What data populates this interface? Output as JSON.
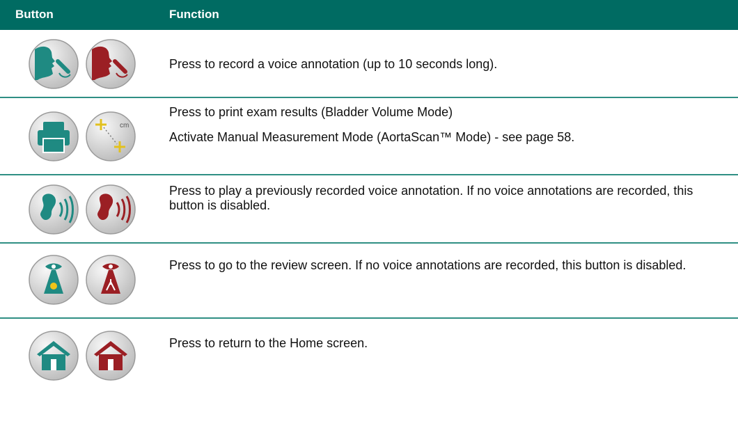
{
  "header": {
    "button": "Button",
    "function": "Function"
  },
  "rows": [
    {
      "icons": [
        "speak-icon-teal",
        "speak-icon-red"
      ],
      "text": [
        "Press to record a voice annotation (up to 10 seconds long)."
      ]
    },
    {
      "icons": [
        "printer-icon",
        "manual-measure-icon"
      ],
      "text": [
        "Press to print exam results (Bladder Volume Mode)",
        "Activate Manual Measurement Mode (AortaScan™ Mode) - see page 58."
      ]
    },
    {
      "icons": [
        "ear-icon-teal",
        "ear-icon-red"
      ],
      "text": [
        "Press to play a previously recorded voice annotation. If no voice annotations are recorded, this button is disabled."
      ]
    },
    {
      "icons": [
        "review-icon-teal",
        "review-icon-red"
      ],
      "text": [
        "Press to go to the review screen. If no voice annotations are recorded, this button is disabled."
      ]
    },
    {
      "icons": [
        "home-icon-teal",
        "home-icon-red"
      ],
      "text": [
        "Press to return to the Home screen."
      ]
    }
  ],
  "colors": {
    "header_bg": "#006b62",
    "teal": "#1f8a82",
    "red": "#9b1f24",
    "rule": "#2f8f84",
    "icon_bg": "#d6d6d6"
  },
  "measure_label": "cm"
}
